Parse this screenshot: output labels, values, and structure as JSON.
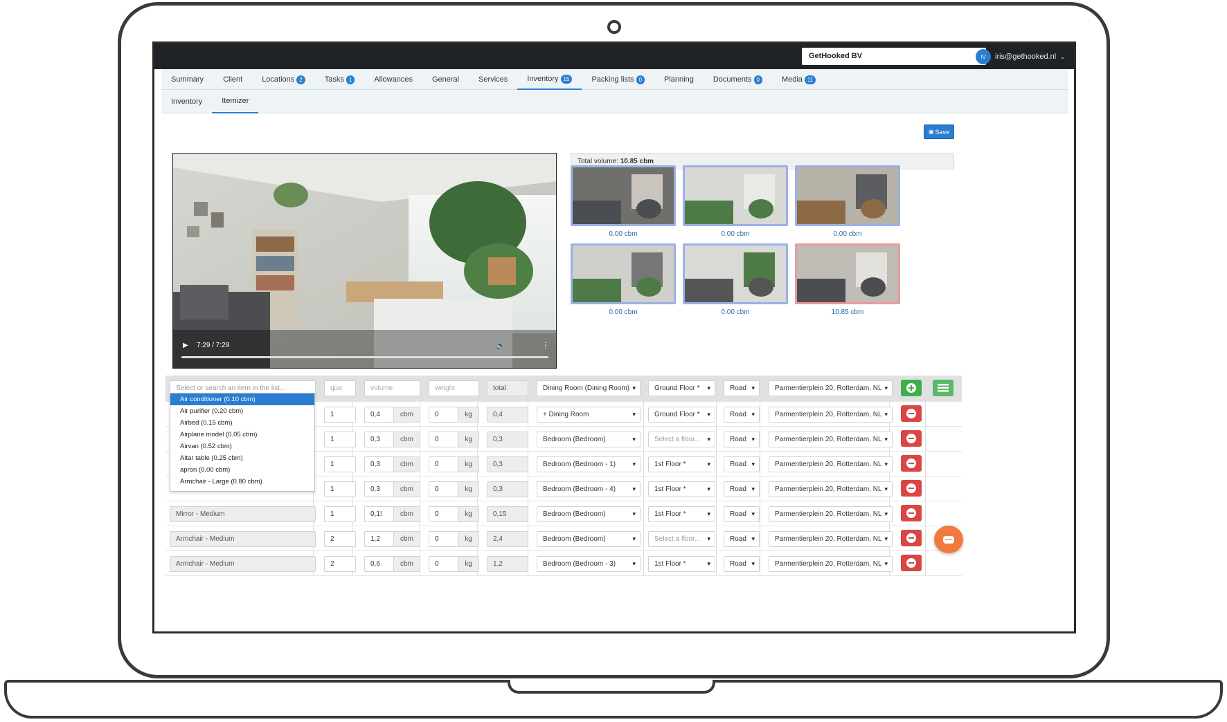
{
  "header": {
    "company": "GetHooked BV",
    "user_initials": "IV",
    "user_email": "iris@gethooked.nl"
  },
  "tabs": [
    {
      "label": "Summary",
      "badge": ""
    },
    {
      "label": "Client",
      "badge": ""
    },
    {
      "label": "Locations",
      "badge": "2"
    },
    {
      "label": "Tasks",
      "badge": "1"
    },
    {
      "label": "Allowances",
      "badge": ""
    },
    {
      "label": "General",
      "badge": ""
    },
    {
      "label": "Services",
      "badge": ""
    },
    {
      "label": "Inventory",
      "badge": "15"
    },
    {
      "label": "Packing lists",
      "badge": "0"
    },
    {
      "label": "Planning",
      "badge": ""
    },
    {
      "label": "Documents",
      "badge": "0"
    },
    {
      "label": "Media",
      "badge": "11"
    }
  ],
  "subtabs": [
    "Inventory",
    "Itemizer"
  ],
  "save_label": "Save",
  "video": {
    "time": "7:29 / 7:29",
    "progress": 1.0
  },
  "total_volume": {
    "label": "Total volume:",
    "value": "10.85 cbm"
  },
  "thumbnails": [
    "0.00 cbm",
    "0.00 cbm",
    "0.00 cbm",
    "0.00 cbm",
    "0.00 cbm",
    "10.85 cbm"
  ],
  "new_item": {
    "search_placeholder": "Select or search an item in the list...",
    "qty_placeholder": "qua",
    "volume_placeholder": "volume",
    "weight_placeholder": "weight",
    "total_placeholder": "total",
    "room": "Dining Room (Dining Room)",
    "floor": "Ground Floor *",
    "transport": "Road",
    "address": "Parmentierplein 20, Rotterdam, NL"
  },
  "dropdown_items": [
    "Air conditioner (0.10 cbm)",
    "Air purifier (0.20 cbm)",
    "Airbed (0.15 cbm)",
    "Airplane model (0.05 cbm)",
    "Airvan (0.52 cbm)",
    "Altar table (0.25 cbm)",
    "apron (0.00 cbm)",
    "Armchair - Large (0.80 cbm)"
  ],
  "units": {
    "volume": "cbm",
    "weight": "kg"
  },
  "rows": [
    {
      "item": "",
      "qty": "1",
      "volume": "0,4",
      "weight": "0",
      "total": "0,4",
      "room": "+ Dining Room",
      "floor": "Ground Floor *",
      "floor_placeholder": false,
      "transport": "Road",
      "address": "Parmentierplein 20, Rotterdam, NL"
    },
    {
      "item": "",
      "qty": "1",
      "volume": "0,3",
      "weight": "0",
      "total": "0,3",
      "room": "Bedroom (Bedroom)",
      "floor": "Select a floor...",
      "floor_placeholder": true,
      "transport": "Road",
      "address": "Parmentierplein 20, Rotterdam, NL"
    },
    {
      "item": "",
      "qty": "1",
      "volume": "0,3",
      "weight": "0",
      "total": "0,3",
      "room": "Bedroom (Bedroom - 1)",
      "floor": "1st Floor *",
      "floor_placeholder": false,
      "transport": "Road",
      "address": "Parmentierplein 20, Rotterdam, NL"
    },
    {
      "item": "",
      "qty": "1",
      "volume": "0,3",
      "weight": "0",
      "total": "0,3",
      "room": "Bedroom (Bedroom - 4)",
      "floor": "1st Floor *",
      "floor_placeholder": false,
      "transport": "Road",
      "address": "Parmentierplein 20, Rotterdam, NL"
    },
    {
      "item": "Mirror - Medium",
      "qty": "1",
      "volume": "0,1!",
      "weight": "0",
      "total": "0,15",
      "room": "Bedroom (Bedroom)",
      "floor": "1st Floor *",
      "floor_placeholder": false,
      "transport": "Road",
      "address": "Parmentierplein 20, Rotterdam, NL"
    },
    {
      "item": "Armchair - Medium",
      "qty": "2",
      "volume": "1,2",
      "weight": "0",
      "total": "2,4",
      "room": "Bedroom (Bedroom)",
      "floor": "Select a floor...",
      "floor_placeholder": true,
      "transport": "Road",
      "address": "Parmentierplein 20, Rotterdam, NL"
    },
    {
      "item": "Armchair - Medium",
      "qty": "2",
      "volume": "0,6",
      "weight": "0",
      "total": "1,2",
      "room": "Bedroom (Bedroom - 3)",
      "floor": "1st Floor *",
      "floor_placeholder": false,
      "transport": "Road",
      "address": "Parmentierplein 20, Rotterdam, NL"
    }
  ],
  "colors": {
    "accent": "#2a7ed2",
    "danger": "#d94645",
    "success": "#3fae49",
    "chat": "#f27a3f"
  }
}
